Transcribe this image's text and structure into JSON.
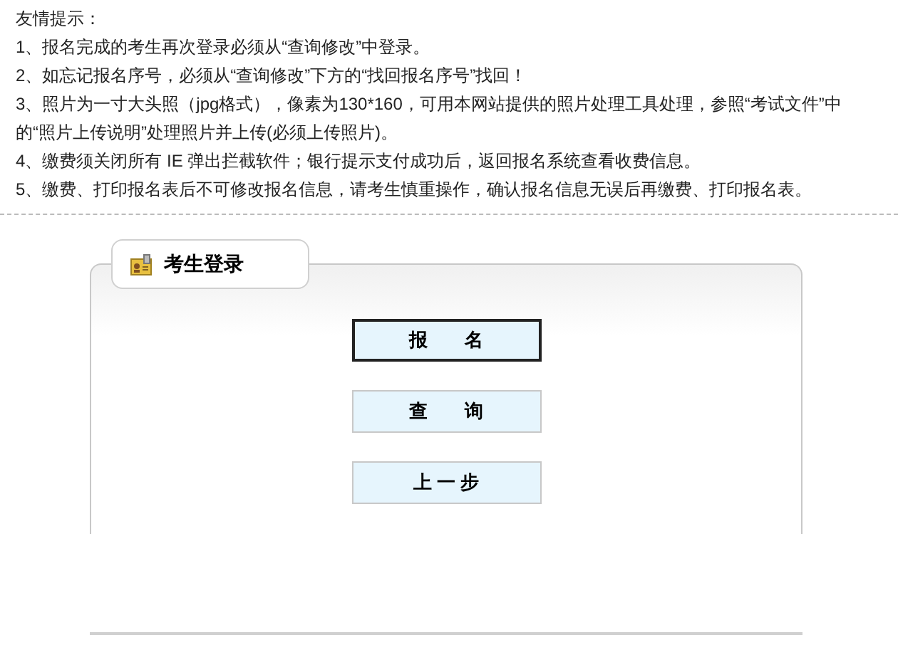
{
  "notice": {
    "title": "友情提示：",
    "items": [
      "1、报名完成的考生再次登录必须从“查询修改”中登录。",
      "2、如忘记报名序号，必须从“查询修改”下方的“找回报名序号”找回！",
      "3、照片为一寸大头照（jpg格式），像素为130*160，可用本网站提供的照片处理工具处理，参照“考试文件”中的“照片上传说明”处理照片并上传(必须上传照片)。",
      "4、缴费须关闭所有 IE 弹出拦截软件；银行提示支付成功后，返回报名系统查看收费信息。",
      "5、缴费、打印报名表后不可修改报名信息，请考生慎重操作，确认报名信息无误后再缴费、打印报名表。"
    ]
  },
  "login_panel": {
    "title": "考生登录",
    "buttons": [
      {
        "label": "报　　名",
        "selected": true
      },
      {
        "label": "查　　询",
        "selected": false
      },
      {
        "label": "上 一 步",
        "selected": false
      }
    ]
  }
}
